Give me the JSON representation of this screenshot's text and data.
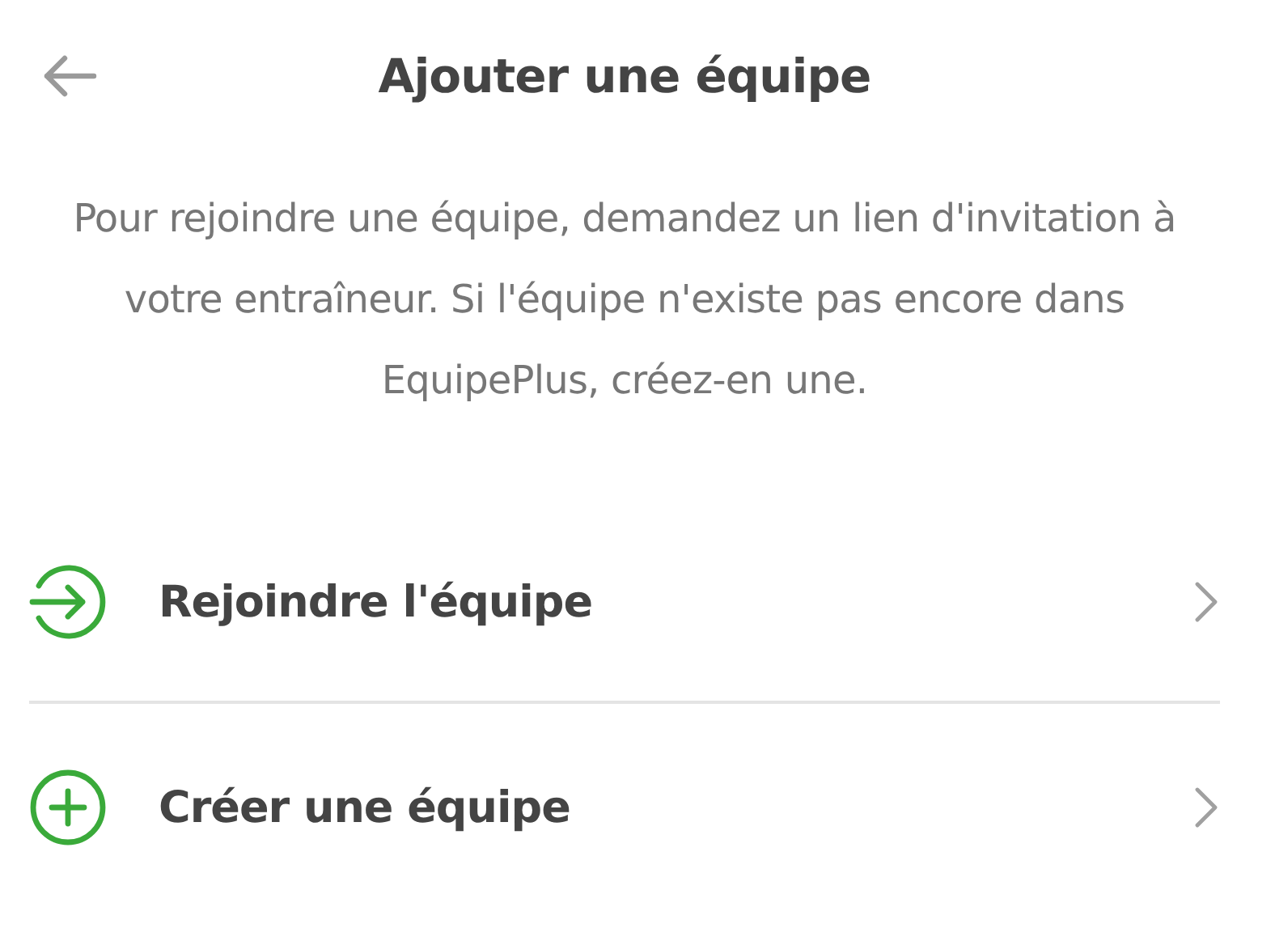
{
  "header": {
    "title": "Ajouter une équipe"
  },
  "intro": "Pour rejoindre une équipe, demandez un lien d'invitation à votre entraîneur. Si l'équipe n'existe pas encore dans EquipePlus, créez-en une.",
  "options": [
    {
      "kind": "join",
      "label": "Rejoindre l'équipe"
    },
    {
      "kind": "create",
      "label": "Créer une équipe"
    }
  ]
}
